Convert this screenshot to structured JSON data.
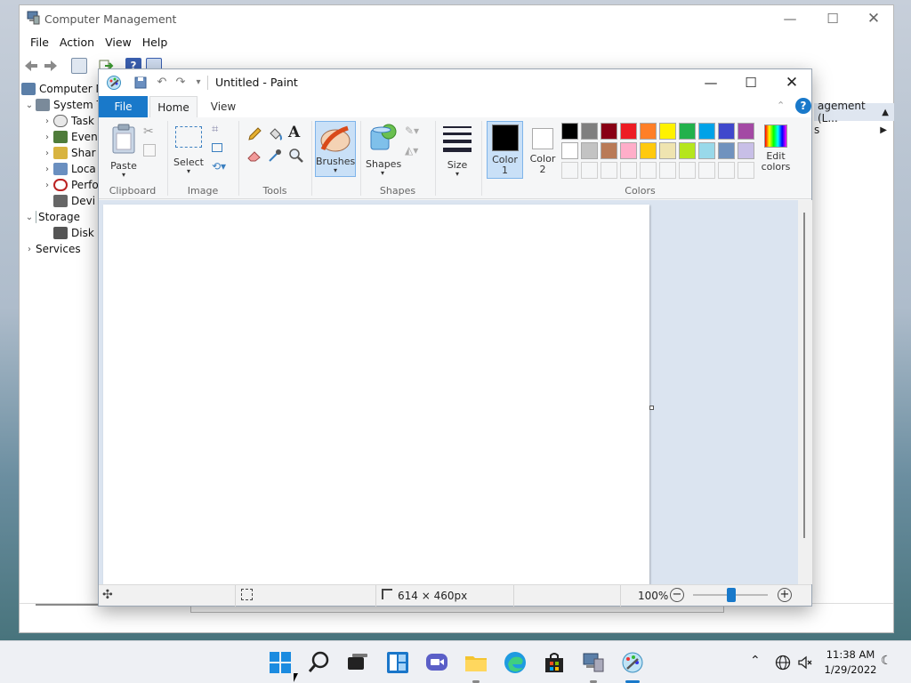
{
  "computer_management": {
    "title": "Computer Management",
    "menu": [
      "File",
      "Action",
      "Help",
      "View"
    ],
    "menu_ordered": [
      "File",
      "Action",
      "View",
      "Help"
    ],
    "tree": [
      {
        "label": "Computer M",
        "level": 0,
        "arrow": ""
      },
      {
        "label": "System T",
        "level": 1,
        "arrow": "v"
      },
      {
        "label": "Task",
        "level": 2,
        "arrow": ">"
      },
      {
        "label": "Even",
        "level": 2,
        "arrow": ">"
      },
      {
        "label": "Shar",
        "level": 2,
        "arrow": ">"
      },
      {
        "label": "Loca",
        "level": 2,
        "arrow": ">"
      },
      {
        "label": "Perfo",
        "level": 2,
        "arrow": ">"
      },
      {
        "label": "Devi",
        "level": 2,
        "arrow": ""
      },
      {
        "label": "Storage",
        "level": 1,
        "arrow": "v"
      },
      {
        "label": "Disk",
        "level": 2,
        "arrow": ""
      },
      {
        "label": "Services",
        "level": 1,
        "arrow": ">"
      }
    ],
    "actions_header": "agement (L...",
    "actions_item": "s"
  },
  "paint": {
    "title": "Untitled - Paint",
    "tabs": {
      "file": "File",
      "home": "Home",
      "view": "View"
    },
    "groups": {
      "clipboard": "Clipboard",
      "image": "Image",
      "tools": "Tools",
      "shapes": "Shapes",
      "colors": "Colors"
    },
    "buttons": {
      "paste": "Paste",
      "select": "Select",
      "brushes": "Brushes",
      "shapes": "Shapes",
      "size": "Size",
      "color1": "Color",
      "color1_num": "1",
      "color2": "Color",
      "color2_num": "2",
      "edit_colors": "Edit",
      "edit_colors2": "colors"
    },
    "palette_row1": [
      "#000000",
      "#7f7f7f",
      "#880015",
      "#ed1c24",
      "#ff7f27",
      "#fff200",
      "#22b14c",
      "#00a2e8",
      "#3f48cc",
      "#a349a4"
    ],
    "palette_row2": [
      "#ffffff",
      "#c3c3c3",
      "#b97a57",
      "#ffaec9",
      "#ffc90e",
      "#efe4b0",
      "#b5e61d",
      "#99d9ea",
      "#7092be",
      "#c8bfe7"
    ],
    "status": {
      "size": "614 × 460px",
      "zoom": "100%"
    },
    "color1": "#000000",
    "color2": "#ffffff"
  },
  "taskbar": {
    "time": "11:38 AM",
    "date": "1/29/2022"
  }
}
